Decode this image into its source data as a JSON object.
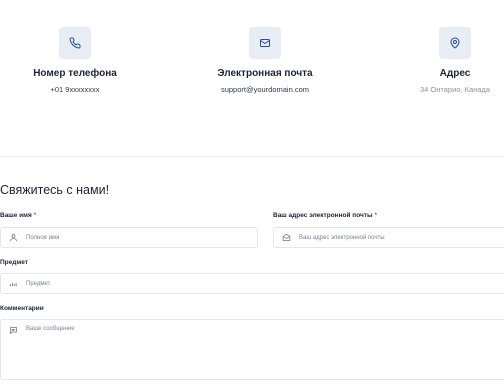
{
  "contacts": [
    {
      "icon": "phone-icon",
      "title": "Номер телефона",
      "value": "+01 9xxxxxxxx"
    },
    {
      "icon": "mail-icon",
      "title": "Электронная почта",
      "value": "support@yourdomain.com"
    },
    {
      "icon": "map-pin-icon",
      "title": "Адрес",
      "value": "34 Онтарио, Канада"
    }
  ],
  "form": {
    "title": "Свяжитесь с нами!",
    "required_mark": "*",
    "name": {
      "label": "Ваше имя",
      "placeholder": "Полное имя",
      "icon": "user-icon"
    },
    "email": {
      "label": "Ваш адрес электронной почты",
      "placeholder": "Ваш адрес электронной почты",
      "icon": "envelope-icon"
    },
    "subject": {
      "label": "Предмет",
      "placeholder": "Предмет",
      "icon": "subject-icon"
    },
    "comments": {
      "label": "Комментарии",
      "placeholder": "Ваше сообщение",
      "icon": "message-icon"
    }
  },
  "colors": {
    "icon_bg": "#e8ecf5",
    "accent": "#2f4a8a",
    "required": "#e5484d",
    "border": "#e2e6ee"
  }
}
